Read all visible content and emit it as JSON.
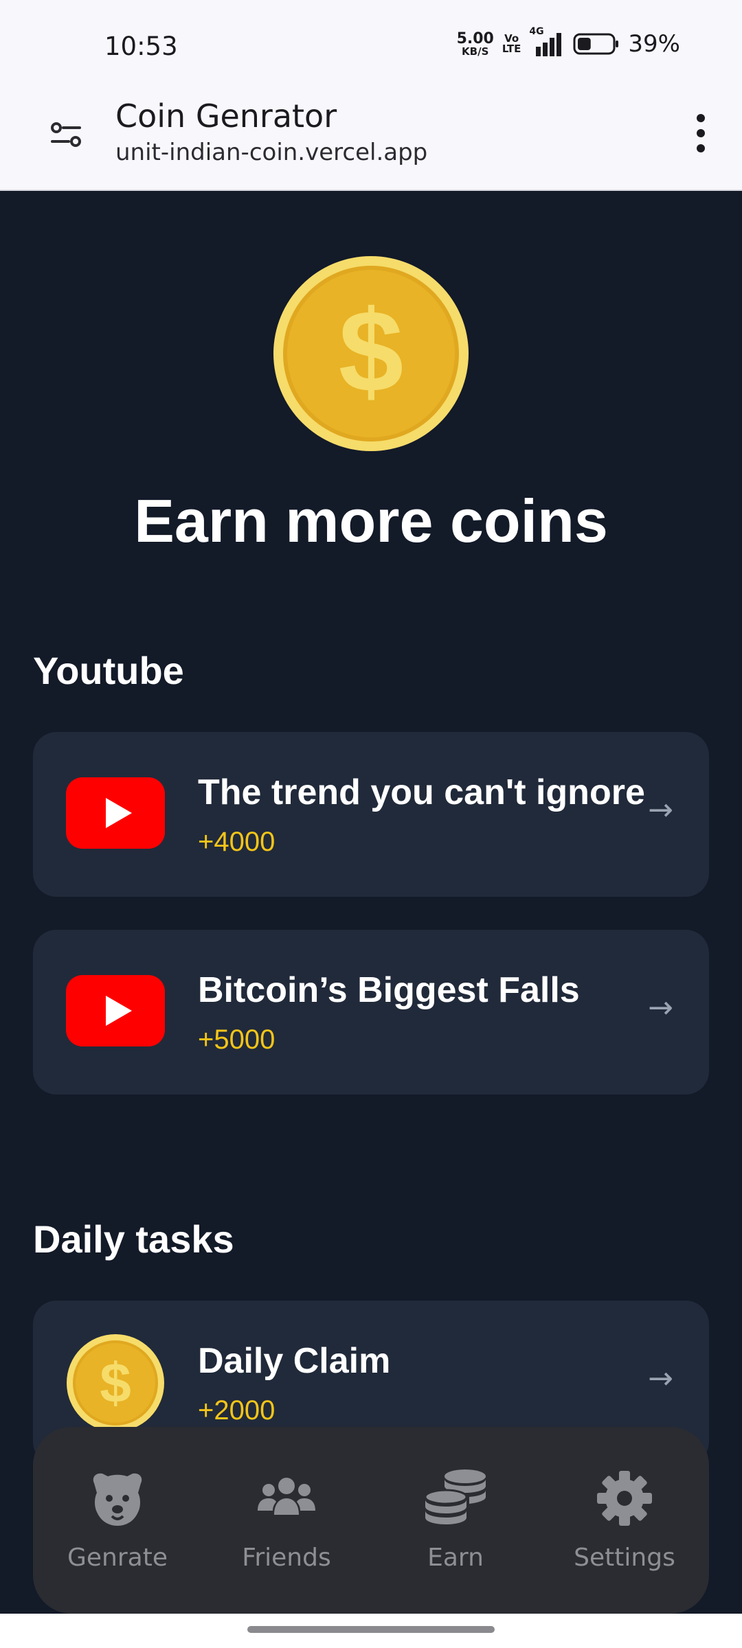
{
  "status_bar": {
    "time": "10:53",
    "net_speed_value": "5.00",
    "net_speed_unit": "KB/S",
    "volte_top": "Vo",
    "volte_bottom": "LTE",
    "network": "4G",
    "battery": "39%",
    "battery_level": 0.39
  },
  "browser": {
    "title": "Coin Genrator",
    "url": "unit-indian-coin.vercel.app"
  },
  "hero": {
    "title": "Earn more coins"
  },
  "youtube": {
    "section_title": "Youtube",
    "items": [
      {
        "title": "The trend you can't ignore",
        "reward": "+4000",
        "arrow": "→"
      },
      {
        "title": "Bitcoin’s Biggest Falls",
        "reward": "+5000",
        "arrow": "→"
      }
    ]
  },
  "daily": {
    "section_title": "Daily tasks",
    "items": [
      {
        "title": "Daily Claim",
        "reward": "+2000",
        "arrow": "→"
      }
    ]
  },
  "nav": {
    "items": [
      {
        "label": "Genrate",
        "icon": "dog-icon"
      },
      {
        "label": "Friends",
        "icon": "users-icon"
      },
      {
        "label": "Earn",
        "icon": "coins-icon"
      },
      {
        "label": "Settings",
        "icon": "gear-icon"
      }
    ]
  },
  "colors": {
    "background": "#131a28",
    "card": "#212a3a",
    "reward": "#f5c518",
    "youtube_red": "#ff0000",
    "nav_bg": "#2a2c31"
  }
}
